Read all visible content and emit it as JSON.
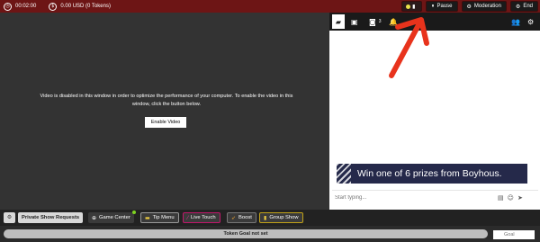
{
  "topbar": {
    "timer": "00:02:00",
    "balance": "0.00 USD (0 Tokens)",
    "pause_label": "Pause",
    "moderation_label": "Moderation",
    "end_label": "End"
  },
  "video": {
    "message": "Video is disabled in this window in order to optimize the performance of your computer. To enable the video in this window, click the button below.",
    "enable_button": "Enable Video"
  },
  "chat": {
    "tabs": [
      {
        "icon": "chat-bubble-icon",
        "active": true
      },
      {
        "icon": "private-chat-icon"
      },
      {
        "icon": "users-icon",
        "count": "3"
      },
      {
        "icon": "bell-icon"
      }
    ],
    "banner_text": "Win one of 6 prizes from Boyhous.",
    "input_placeholder": "Start typing..."
  },
  "toolbar": {
    "private_show_requests": "Private Show Requests",
    "game_center": "Game Center",
    "tip_menu": "Tip Menu",
    "live_touch": "Live Touch",
    "boost": "Boost",
    "group_show": "Group Show"
  },
  "goal": {
    "status_text": "Token Goal not set",
    "input_placeholder": "Goal"
  },
  "colors": {
    "topbar": "#6d1515",
    "arrow": "#e8331c",
    "live_touch": "#c0176a",
    "group_show": "#c2a218"
  }
}
